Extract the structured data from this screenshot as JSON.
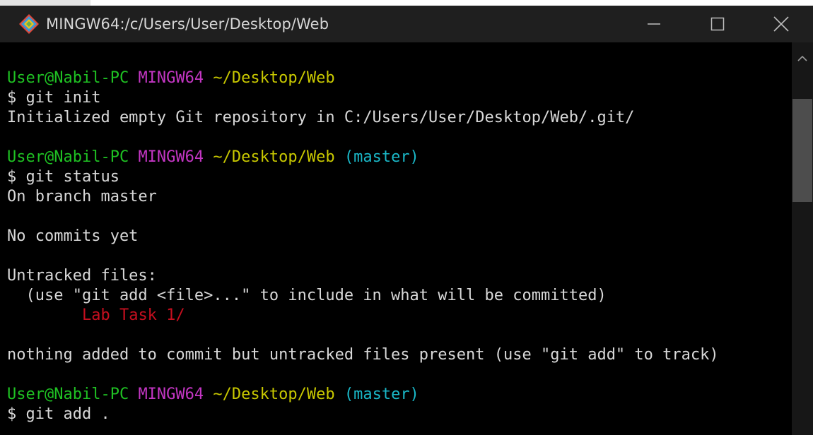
{
  "window": {
    "title": "MINGW64:/c/Users/User/Desktop/Web",
    "icons": {
      "app": "git-diamond-icon",
      "minimize": "minimize-icon",
      "maximize": "maximize-icon",
      "close": "close-icon",
      "scroll_up": "chevron-up-icon"
    },
    "colors": {
      "prompt_user": "#1fc123",
      "prompt_system": "#c436c4",
      "prompt_path": "#c8c800",
      "prompt_branch": "#1ab8c8",
      "untracked": "#c50f1f",
      "output": "#d8d8d8"
    }
  },
  "terminal": {
    "lines": [
      [
        {
          "t": "User@Nabil-PC",
          "c": "green"
        },
        {
          "t": " "
        },
        {
          "t": "MINGW64",
          "c": "magenta"
        },
        {
          "t": " "
        },
        {
          "t": "~/Desktop/Web",
          "c": "yellow"
        }
      ],
      [
        {
          "t": "$ git init"
        }
      ],
      [
        {
          "t": "Initialized empty Git repository in C:/Users/User/Desktop/Web/.git/"
        }
      ],
      [],
      [
        {
          "t": "User@Nabil-PC",
          "c": "green"
        },
        {
          "t": " "
        },
        {
          "t": "MINGW64",
          "c": "magenta"
        },
        {
          "t": " "
        },
        {
          "t": "~/Desktop/Web",
          "c": "yellow"
        },
        {
          "t": " "
        },
        {
          "t": "(master)",
          "c": "cyan"
        }
      ],
      [
        {
          "t": "$ git status"
        }
      ],
      [
        {
          "t": "On branch master"
        }
      ],
      [],
      [
        {
          "t": "No commits yet"
        }
      ],
      [],
      [
        {
          "t": "Untracked files:"
        }
      ],
      [
        {
          "t": "  (use \"git add <file>...\" to include in what will be committed)"
        }
      ],
      [
        {
          "t": "        "
        },
        {
          "t": "Lab Task 1/",
          "c": "red"
        }
      ],
      [],
      [
        {
          "t": "nothing added to commit but untracked files present (use \"git add\" to track)"
        }
      ],
      [],
      [
        {
          "t": "User@Nabil-PC",
          "c": "green"
        },
        {
          "t": " "
        },
        {
          "t": "MINGW64",
          "c": "magenta"
        },
        {
          "t": " "
        },
        {
          "t": "~/Desktop/Web",
          "c": "yellow"
        },
        {
          "t": " "
        },
        {
          "t": "(master)",
          "c": "cyan"
        }
      ],
      [
        {
          "t": "$ git add ."
        }
      ]
    ]
  }
}
